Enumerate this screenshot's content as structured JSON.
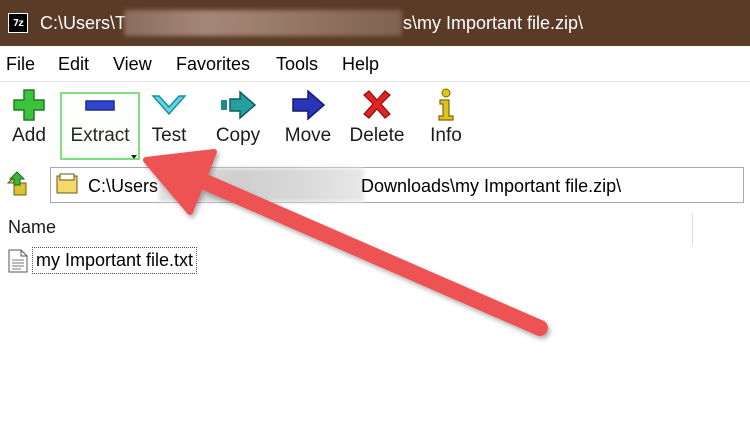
{
  "window": {
    "app_icon_text": "7z",
    "title_prefix": "C:\\Users\\T",
    "title_suffix": "s\\my Important file.zip\\"
  },
  "menu": {
    "items": [
      "File",
      "Edit",
      "View",
      "Favorites",
      "Tools",
      "Help"
    ]
  },
  "toolbar": {
    "add": "Add",
    "extract": "Extract",
    "test": "Test",
    "copy": "Copy",
    "move": "Move",
    "delete": "Delete",
    "info": "Info"
  },
  "address": {
    "prefix": "C:\\Users",
    "suffix": "Downloads\\my Important file.zip\\"
  },
  "list": {
    "column_name": "Name",
    "files": [
      {
        "name": "my Important file.txt"
      }
    ]
  },
  "colors": {
    "titlebar": "#5a3b27",
    "highlight": "#7ee07e",
    "arrow": "#ee5252"
  },
  "icons": {
    "add": "green-plus-icon",
    "extract": "blue-minus-icon",
    "test": "check-chevron-icon",
    "copy": "double-arrow-icon",
    "move": "right-arrow-icon",
    "delete": "red-x-icon",
    "info": "info-icon"
  }
}
